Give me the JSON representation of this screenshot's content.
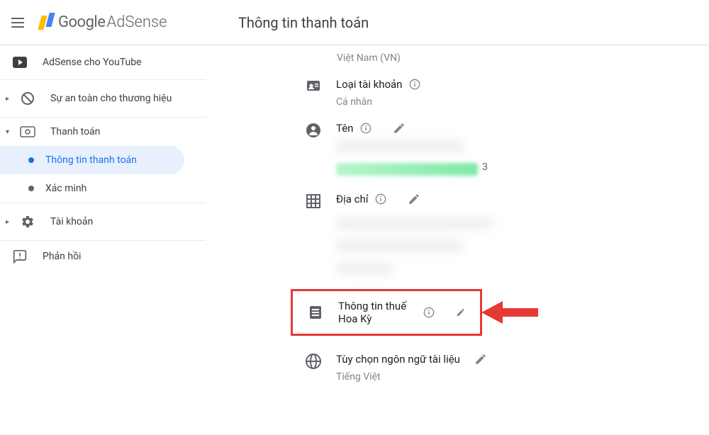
{
  "header": {
    "brand_google": "Google",
    "brand_adsense": "AdSense",
    "page_title": "Thông tin thanh toán"
  },
  "sidebar": {
    "items": [
      {
        "label": "AdSense cho YouTube",
        "icon": "youtube"
      },
      {
        "label": "Sự an toàn cho thương hiệu",
        "icon": "no-symbol"
      },
      {
        "label": "Thanh toán",
        "icon": "payment",
        "expandable": true
      },
      {
        "label": "Thông tin thanh toán",
        "sub": true,
        "active": true
      },
      {
        "label": "Xác minh",
        "sub": true
      },
      {
        "label": "Tài khoản",
        "icon": "settings",
        "expandable": true
      },
      {
        "label": "Phản hồi",
        "icon": "feedback"
      }
    ]
  },
  "content": {
    "country_partial": "Việt Nam (VN)",
    "account_type": {
      "label": "Loại tài khoản",
      "value": "Cá nhân"
    },
    "name": {
      "label": "Tên",
      "badge": "3"
    },
    "address": {
      "label": "Địa chỉ"
    },
    "tax_info": {
      "label": "Thông tin thuế Hoa Kỳ"
    },
    "language": {
      "label": "Tùy chọn ngôn ngữ tài liệu",
      "value": "Tiếng Việt"
    }
  }
}
